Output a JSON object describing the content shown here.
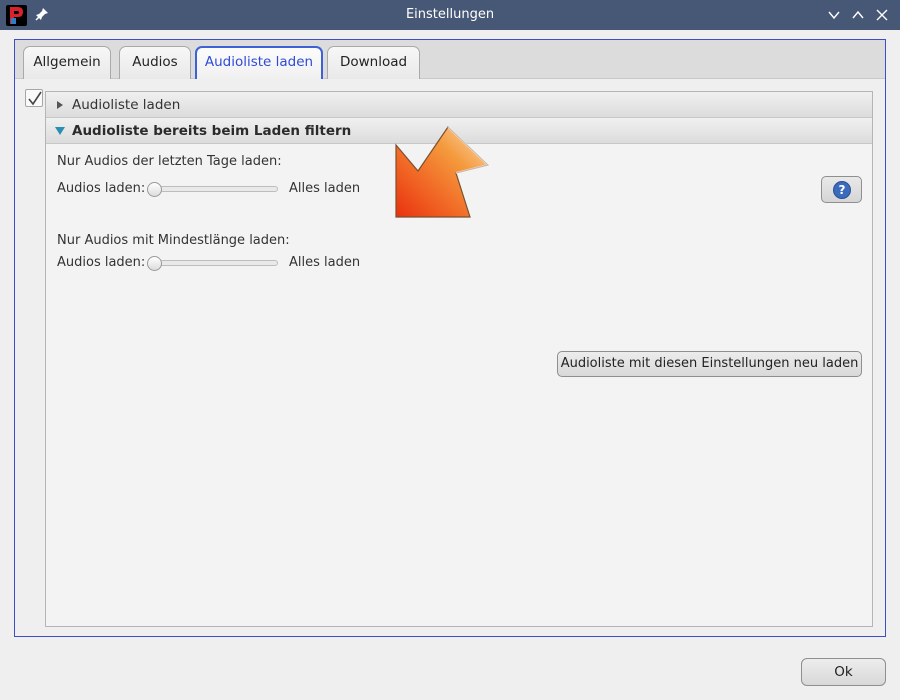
{
  "window": {
    "title": "Einstellungen",
    "icons": [
      "app-logo",
      "pin-icon",
      "chevron-down-icon",
      "chevron-up-icon",
      "close-icon"
    ]
  },
  "tabs": [
    {
      "label": "Allgemein",
      "active": false
    },
    {
      "label": "Audios",
      "active": false
    },
    {
      "label": "Audioliste laden",
      "active": true
    },
    {
      "label": "Download",
      "active": false
    }
  ],
  "accordion": [
    {
      "title": "Audioliste laden",
      "expanded": false
    },
    {
      "title": "Audioliste bereits beim Laden filtern",
      "expanded": true
    }
  ],
  "filters": {
    "days": {
      "heading": "Nur Audios der letzten Tage laden:",
      "label": "Audios laden:",
      "value_text": "Alles laden",
      "slider_level": 0
    },
    "length": {
      "heading": "Nur Audios mit Mindestlänge laden:",
      "label": "Audios laden:",
      "value_text": "Alles laden",
      "slider_level": 0
    }
  },
  "buttons": {
    "help": "?",
    "reload": "Audioliste mit diesen Einstellungen neu laden",
    "ok": "Ok"
  },
  "checkbox": {
    "checked": true
  },
  "colors": {
    "titlebar": "#475776",
    "accent": "#3e62d6",
    "help_icon": "#3b6bbd",
    "arrow_orange": "#f2741f"
  }
}
